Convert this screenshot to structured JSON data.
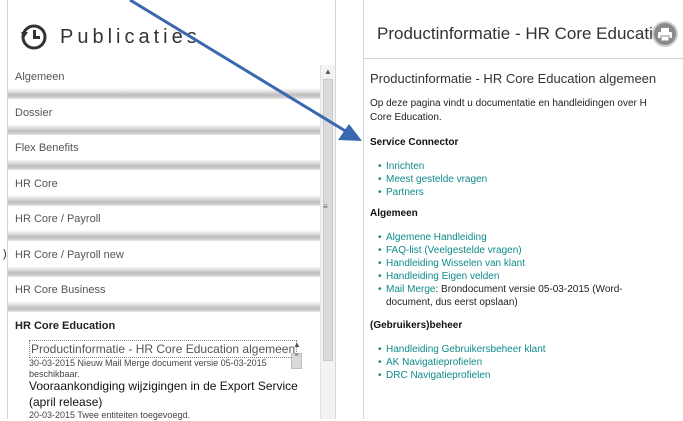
{
  "publications": {
    "title": "Publicaties",
    "categories": [
      "Algemeen",
      "Dossier",
      "Flex Benefits",
      "HR Core",
      "HR Core / Payroll",
      "HR Core / Payroll new",
      "HR Core Business",
      "HR Core Education"
    ],
    "side_marker": ")",
    "sub_items": [
      {
        "title": "Productinformatie - HR Core Education algemeen",
        "desc_line1": "30-03-2015 Nieuw Mail Merge document versie 05-03-2015",
        "desc_line2": "beschikbaar."
      },
      {
        "title_line1": "Vooraankondiging wijzigingen in de Export Service",
        "title_line2": "(april release)",
        "desc": "20-03-2015 Twee entiteiten toegevoegd."
      }
    ]
  },
  "detail": {
    "header_title": "Productinformatie - HR Core Educati...",
    "heading": "Productinformatie - HR Core Education algemeen",
    "intro_line1": "Op deze pagina vindt u documentatie en handleidingen over H",
    "intro_line2": "Core Education.",
    "sections": {
      "service_connector": {
        "title": "Service Connector",
        "links": [
          "Inrichten",
          "Meest gestelde vragen",
          "Partners"
        ]
      },
      "algemeen": {
        "title": "Algemeen",
        "links": [
          "Algemene Handleiding",
          "FAQ-list (Veelgestelde vragen)",
          "Handleiding Wisselen van klant",
          "Handleiding Eigen velden"
        ],
        "mail_merge_link": "Mail Merge",
        "mail_merge_text_line1": ": Brondocument versie 05-03-2015 (Word-",
        "mail_merge_text_line2": "document, dus eerst opslaan)"
      },
      "beheer": {
        "title": "(Gebruikers)beheer",
        "links": [
          "Handleiding Gebruikersbeheer klant",
          "AK Navigatieprofielen",
          "DRC Navigatieprofielen"
        ]
      }
    }
  },
  "icons": {
    "publications_icon": "history-icon",
    "print_icon": "print-icon",
    "bullet": "•"
  },
  "colors": {
    "link": "#0f8a8a",
    "arrow": "#3a68b0"
  }
}
